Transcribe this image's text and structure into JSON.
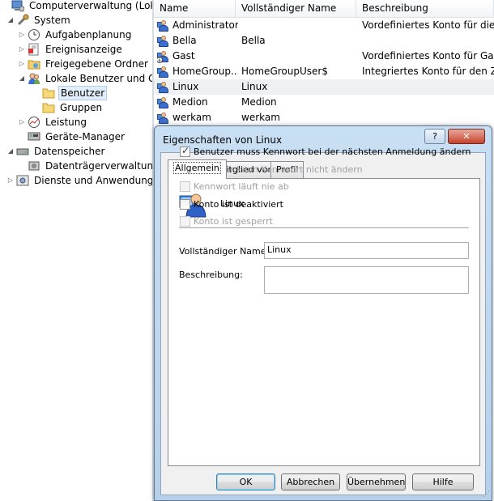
{
  "tree": {
    "items": [
      {
        "label": "Computerverwaltung (Lokal)",
        "icon": "computer-management-icon",
        "level": 0,
        "expander": ""
      },
      {
        "label": "System",
        "icon": "system-tools-icon",
        "level": 1,
        "expander": "◢"
      },
      {
        "label": "Aufgabenplanung",
        "icon": "clock-icon",
        "level": 2,
        "expander": "▷"
      },
      {
        "label": "Ereignisanzeige",
        "icon": "event-viewer-icon",
        "level": 2,
        "expander": "▷"
      },
      {
        "label": "Freigegebene Ordner",
        "icon": "shared-folder-icon",
        "level": 2,
        "expander": "▷"
      },
      {
        "label": "Lokale Benutzer und Gruppen",
        "icon": "users-groups-icon",
        "level": 2,
        "expander": "◢"
      },
      {
        "label": "Benutzer",
        "icon": "folder-icon",
        "level": 3,
        "expander": "",
        "selected": true
      },
      {
        "label": "Gruppen",
        "icon": "folder-icon",
        "level": 3,
        "expander": ""
      },
      {
        "label": "Leistung",
        "icon": "performance-icon",
        "level": 2,
        "expander": "▷"
      },
      {
        "label": "Geräte-Manager",
        "icon": "device-manager-icon",
        "level": 2,
        "expander": ""
      },
      {
        "label": "Datenspeicher",
        "icon": "storage-icon",
        "level": 1,
        "expander": "◢"
      },
      {
        "label": "Datenträgerverwaltung",
        "icon": "disk-management-icon",
        "level": 2,
        "expander": ""
      },
      {
        "label": "Dienste und Anwendungen",
        "icon": "services-icon",
        "level": 1,
        "expander": "▷"
      }
    ]
  },
  "list": {
    "columns": [
      "Name",
      "Vollständiger Name",
      "Beschreibung"
    ],
    "rows": [
      {
        "name": "Administrator",
        "full": "",
        "desc": "Vordefiniertes Konto für die Ve"
      },
      {
        "name": "Bella",
        "full": "Bella",
        "desc": ""
      },
      {
        "name": "Gast",
        "full": "",
        "desc": "Vordefiniertes Konto für Gastzu",
        "disabled": true
      },
      {
        "name": "HomeGroup...",
        "full": "HomeGroupUser$",
        "desc": "Integriertes Konto für den Zugr"
      },
      {
        "name": "Linux",
        "full": "Linux",
        "desc": "",
        "hover": true
      },
      {
        "name": "Medion",
        "full": "Medion",
        "desc": ""
      },
      {
        "name": "werkam",
        "full": "werkam",
        "desc": ""
      }
    ]
  },
  "dialog": {
    "title": "Eigenschaften von Linux",
    "help_label": "?",
    "close_label": "✕",
    "tabs": [
      "Allgemein",
      "Mitglied von",
      "Profil"
    ],
    "user_name": "Linux",
    "full_name_label": "Vollständiger Name:",
    "full_name_value": "Linux",
    "description_label": "Beschreibung:",
    "description_value": "",
    "checkboxes": [
      {
        "label": "Benutzer muss Kennwort bei der nächsten Anmeldung ändern",
        "checked": true,
        "enabled": true
      },
      {
        "label": "Benutzer kann Kennwort nicht ändern",
        "checked": false,
        "enabled": false
      },
      {
        "label": "Kennwort läuft nie ab",
        "checked": false,
        "enabled": false
      },
      {
        "label": "Konto ist deaktiviert",
        "checked": false,
        "enabled": true
      },
      {
        "label": "Konto ist gesperrt",
        "checked": false,
        "enabled": false
      }
    ],
    "buttons": {
      "ok": "OK",
      "cancel": "Abbrechen",
      "apply": "Übernehmen",
      "help": "Hilfe"
    }
  }
}
